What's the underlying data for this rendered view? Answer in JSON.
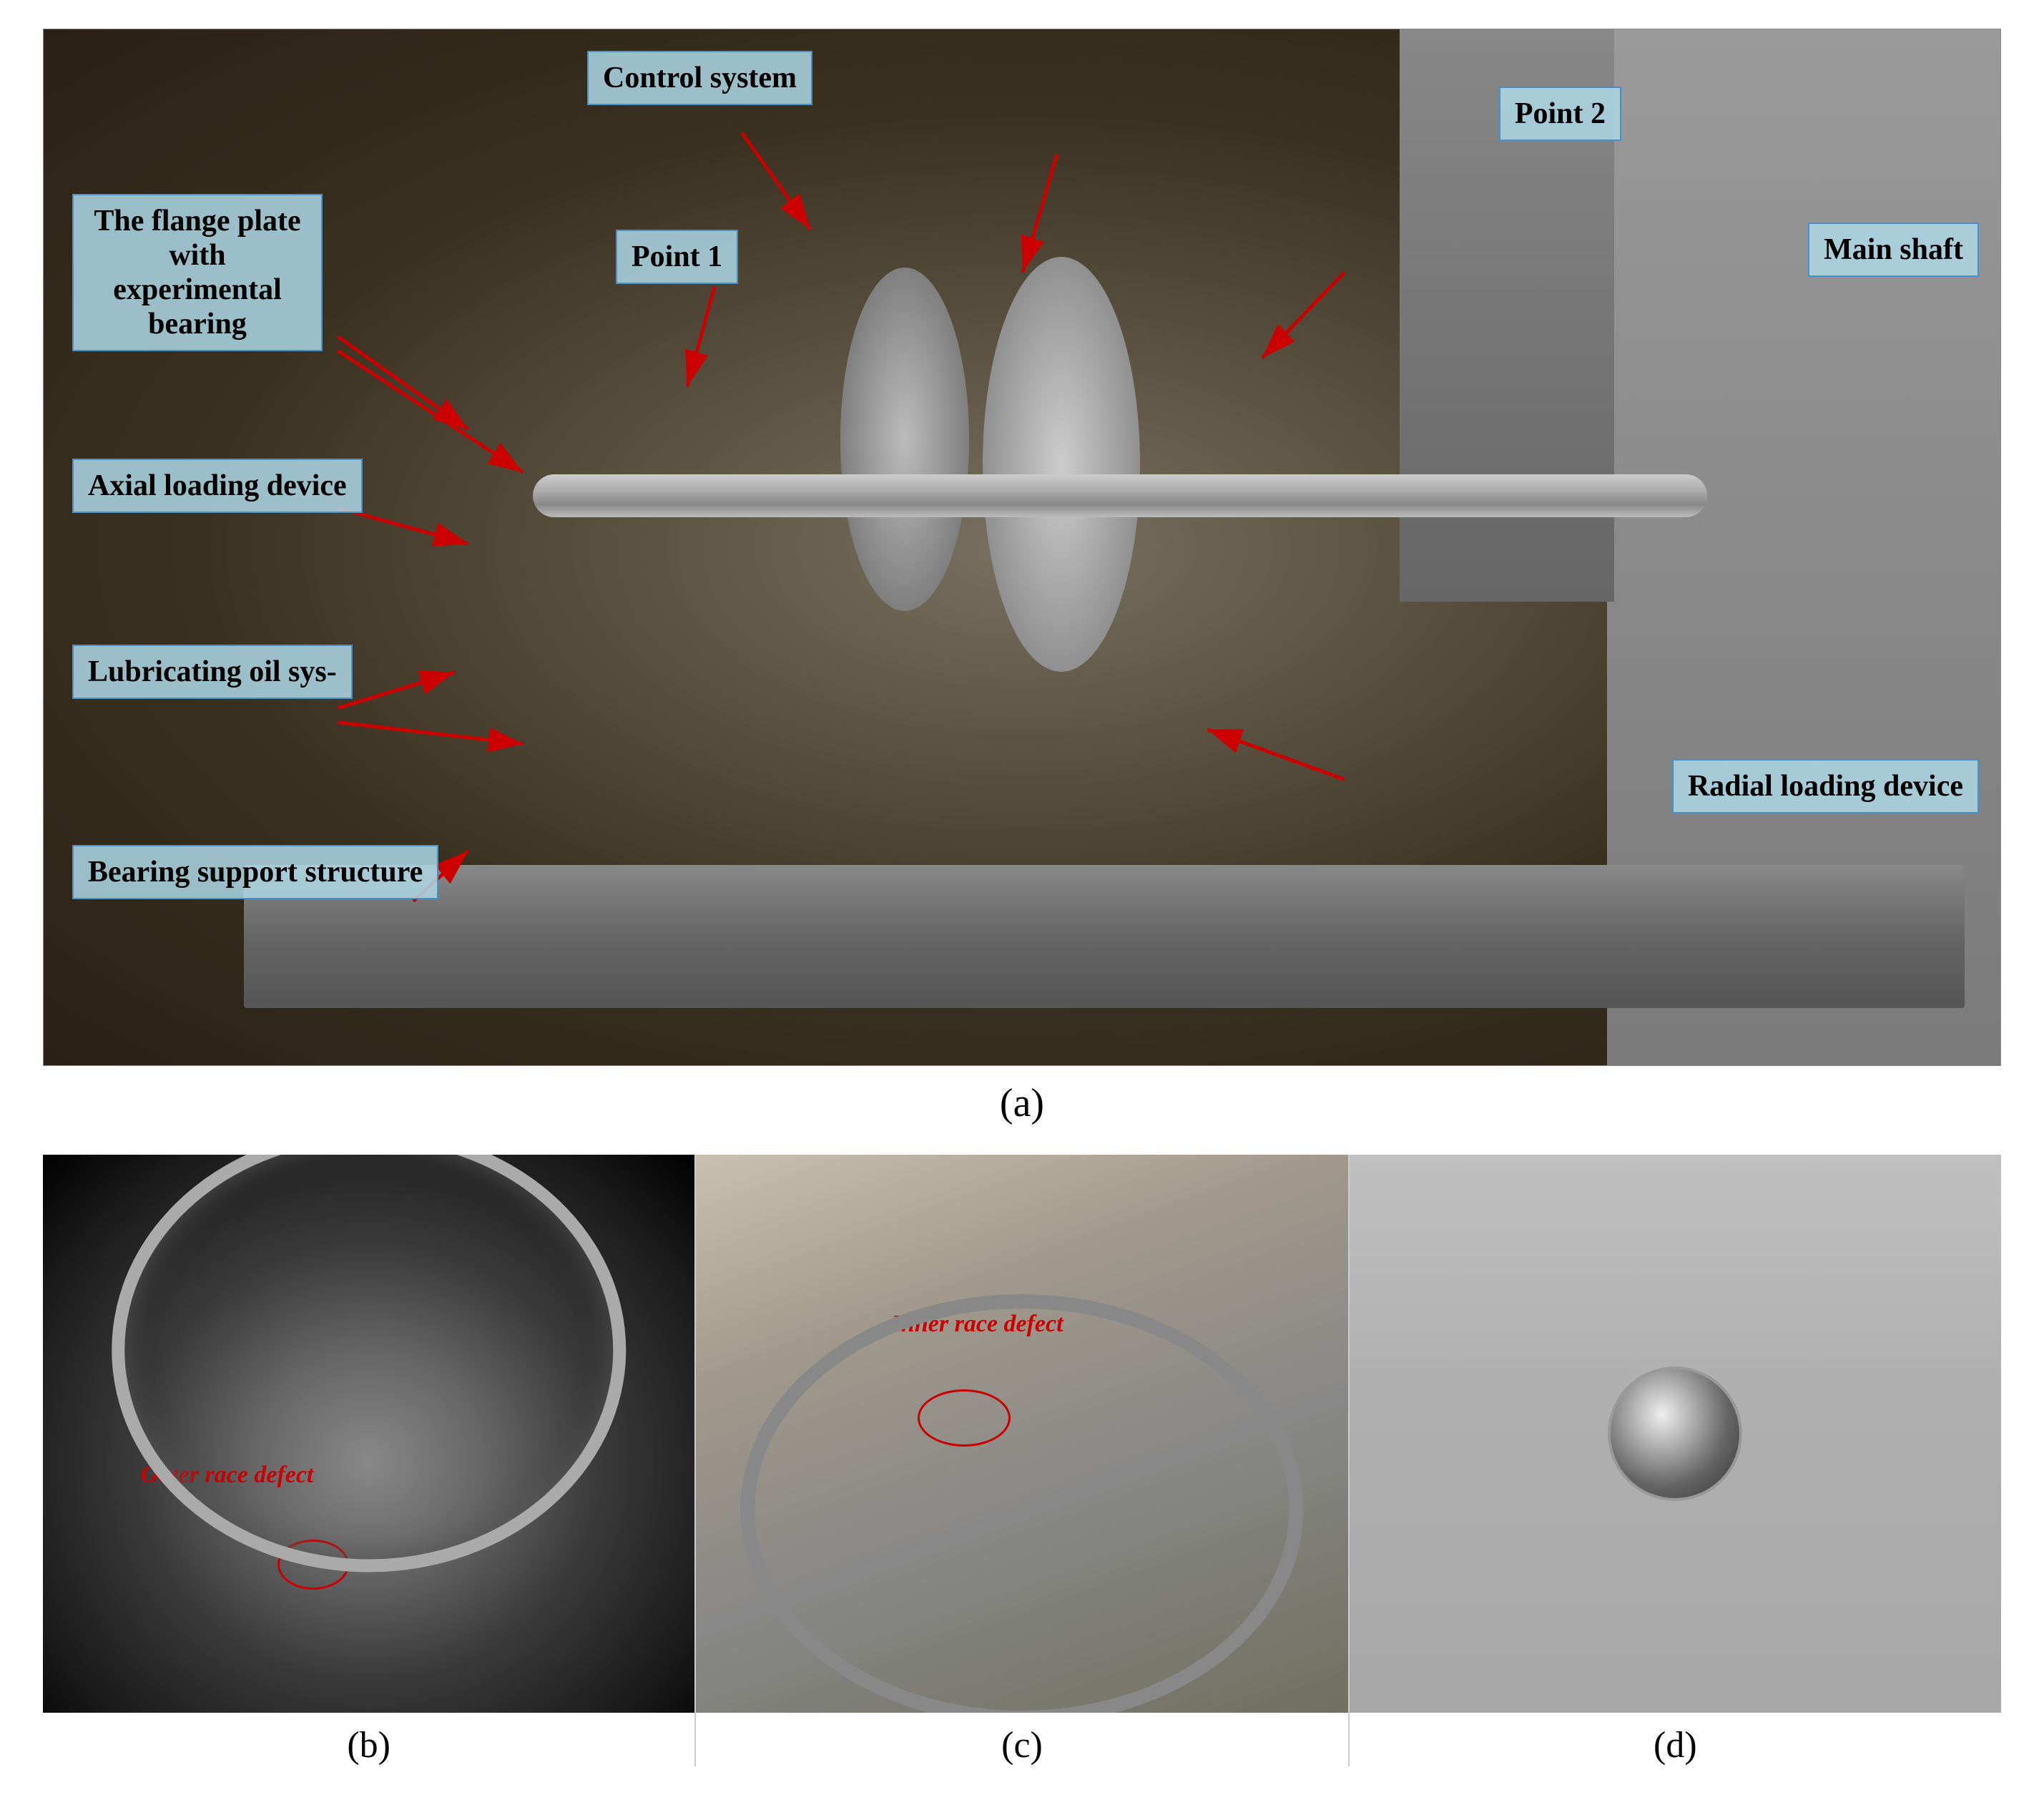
{
  "figure_a": {
    "caption": "(a)",
    "labels": {
      "control_system": "Control system",
      "point2": "Point 2",
      "flange_plate": "The flange plate with experimental bearing",
      "point1": "Point 1",
      "main_shaft": "Main shaft",
      "axial_loading": "Axial loading device",
      "lubricating": "Lubricating oil sys-",
      "radial_loading": "Radial loading device",
      "bearing_support": "Bearing support structure"
    }
  },
  "figure_b": {
    "caption": "(b)",
    "defect_label": "Outer race defect"
  },
  "figure_c": {
    "caption": "(c)",
    "defect_label": "Inner race defect"
  },
  "figure_d": {
    "caption": "(d)"
  }
}
